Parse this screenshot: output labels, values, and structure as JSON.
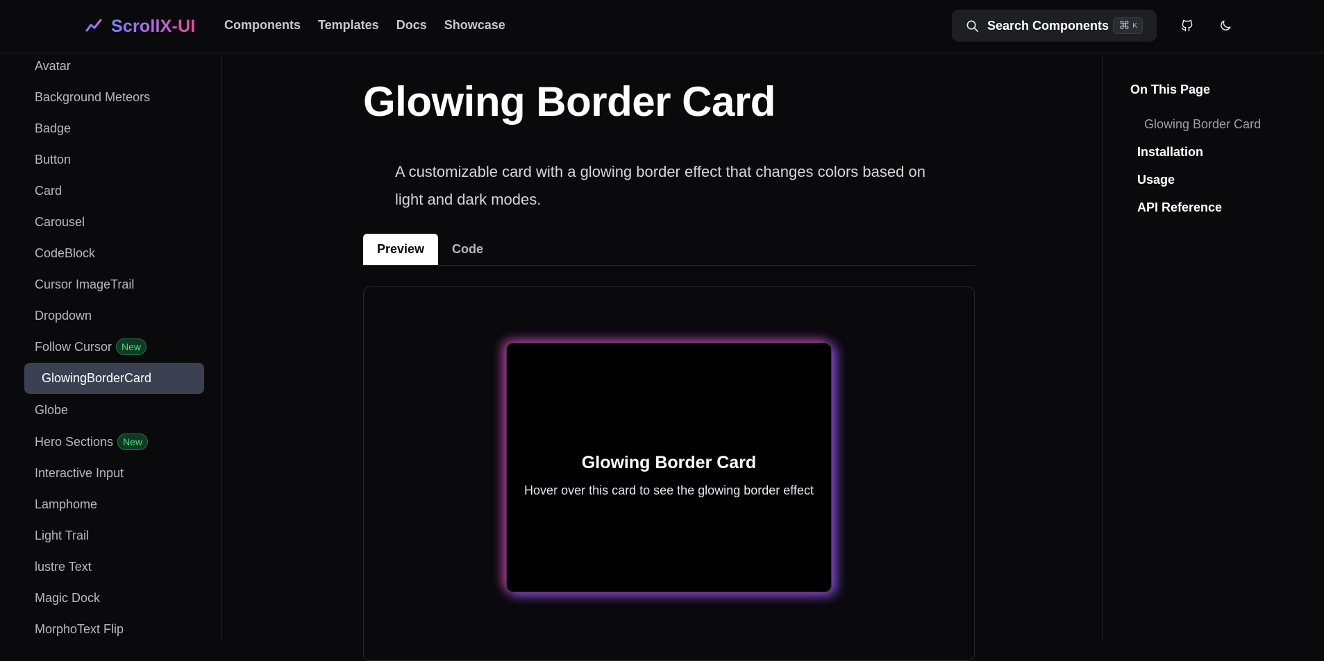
{
  "header": {
    "brand": "ScrollX-UI",
    "nav": [
      "Components",
      "Templates",
      "Docs",
      "Showcase"
    ],
    "search": {
      "label": "Search Components",
      "shortcut_cmd": "⌘",
      "shortcut_key": "K"
    },
    "brand_colors": [
      "#7c83ff",
      "#b36ae8",
      "#ec4899"
    ]
  },
  "sidebar": {
    "items": [
      {
        "label": "Avatar"
      },
      {
        "label": "Background Meteors"
      },
      {
        "label": "Badge"
      },
      {
        "label": "Button"
      },
      {
        "label": "Card"
      },
      {
        "label": "Carousel"
      },
      {
        "label": "CodeBlock"
      },
      {
        "label": "Cursor ImageTrail"
      },
      {
        "label": "Dropdown"
      },
      {
        "label": "Follow Cursor",
        "badge": "New"
      },
      {
        "label": "GlowingBorderCard",
        "active": true
      },
      {
        "label": "Globe"
      },
      {
        "label": "Hero Sections",
        "badge": "New"
      },
      {
        "label": "Interactive Input"
      },
      {
        "label": "Lamphome"
      },
      {
        "label": "Light Trail"
      },
      {
        "label": "lustre Text"
      },
      {
        "label": "Magic Dock"
      },
      {
        "label": "MorphoText Flip"
      }
    ]
  },
  "main": {
    "title": "Glowing Border Card",
    "description": "A customizable card with a glowing border effect that changes colors based on light and dark modes.",
    "tabs": [
      {
        "label": "Preview",
        "active": true
      },
      {
        "label": "Code",
        "active": false
      }
    ],
    "preview_card": {
      "title": "Glowing Border Card",
      "subtitle": "Hover over this card to see the glowing border effect",
      "glow_colors": [
        "#ec4899",
        "#8b5cf6"
      ]
    }
  },
  "toc": {
    "heading": "On This Page",
    "items": [
      {
        "label": "Glowing Border Card",
        "level": 2
      },
      {
        "label": "Installation",
        "level": 1
      },
      {
        "label": "Usage",
        "level": 1
      },
      {
        "label": "API Reference",
        "level": 1
      }
    ]
  }
}
